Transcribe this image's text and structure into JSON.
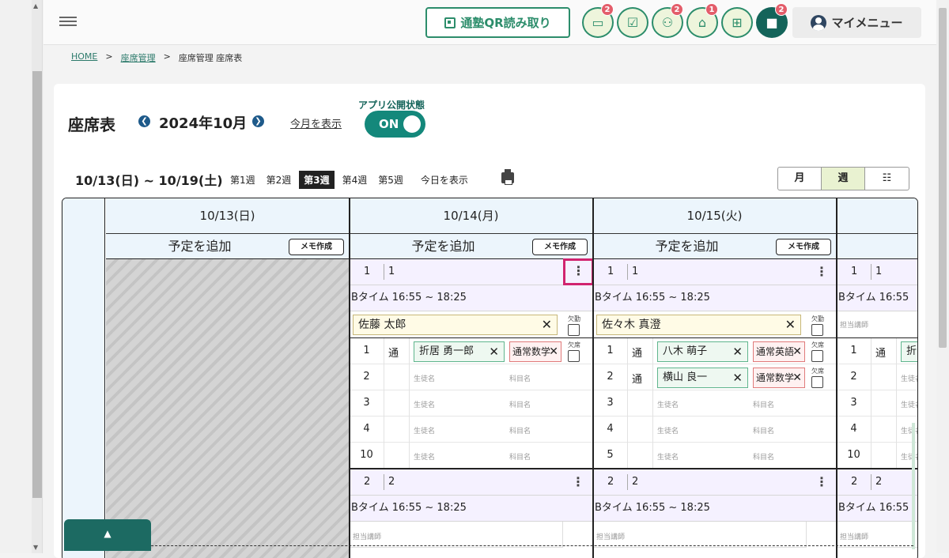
{
  "topbar": {
    "qr_label": "通塾QR読み取り",
    "badges": {
      "chat": "2",
      "survey": "",
      "people": "2",
      "school": "1",
      "gift": "",
      "message": "2"
    },
    "my_menu": "マイメニュー"
  },
  "breadcrumb": {
    "home": "HOME",
    "sep": ">",
    "seat_mgmt": "座席管理",
    "current": "座席管理 座席表"
  },
  "header": {
    "title": "座席表",
    "month": "2024年10月",
    "show_this_month": "今月を表示",
    "publish_label": "アプリ公開状態",
    "publish_toggle": "ON"
  },
  "week_bar": {
    "range": "10/13(日) ~ 10/19(土)",
    "weeks": [
      "第1週",
      "第2週",
      "第3週",
      "第4週",
      "第5週"
    ],
    "selected_week": "第3週",
    "show_today": "今日を表示",
    "views": [
      "月",
      "週",
      "☷"
    ],
    "active_view": "週"
  },
  "calendar": {
    "add_label": "予定を追加",
    "memo_label": "メモ作成",
    "days": [
      {
        "date": "10/13(日)"
      },
      {
        "date": "10/14(月)"
      },
      {
        "date": "10/15(火)"
      },
      {
        "date": ""
      }
    ],
    "placeholders": {
      "student": "生徒名",
      "subject": "科目名",
      "teacher": "担当講師",
      "absent": "欠席",
      "absent_t": "欠勤"
    },
    "cols": [
      {
        "seat1": {
          "a": "1",
          "b": "1"
        },
        "time": "Bタイム 16:55 ~ 18:25",
        "teacher": "佐藤 太郎",
        "rows": [
          {
            "num": "1",
            "type": "通",
            "student": "折居 勇一郎",
            "subject": "通常数学"
          },
          {
            "num": "2"
          },
          {
            "num": "3"
          },
          {
            "num": "4"
          },
          {
            "num": "10"
          }
        ],
        "seat2": {
          "a": "2",
          "b": "2"
        },
        "time2": "Bタイム 16:55 ~ 18:25"
      },
      {
        "seat1": {
          "a": "1",
          "b": "1"
        },
        "time": "Bタイム 16:55 ~ 18:25",
        "teacher": "佐々木 真澄",
        "rows": [
          {
            "num": "1",
            "type": "通",
            "student": "八木 萌子",
            "subject": "通常英語"
          },
          {
            "num": "2",
            "type": "通",
            "student": "横山 良一",
            "subject": "通常数学"
          },
          {
            "num": "3"
          },
          {
            "num": "4"
          },
          {
            "num": "5"
          }
        ],
        "seat2": {
          "a": "2",
          "b": "2"
        },
        "time2": "Bタイム 16:55 ~ 18:25"
      },
      {
        "seat1": {
          "a": "1",
          "b": "1"
        },
        "time": "Bタイム 16:55",
        "rows": [
          {
            "num": "1",
            "type": "通",
            "student": "折"
          },
          {
            "num": "2"
          },
          {
            "num": "3"
          },
          {
            "num": "4"
          },
          {
            "num": "10"
          }
        ],
        "seat2": {
          "a": "2",
          "b": "2"
        },
        "time2": "Bタイム 16:55"
      }
    ]
  },
  "colors": {
    "accent": "#2c8d6b",
    "dark_accent": "#14645a",
    "badge": "#e35d6a",
    "highlight": "#d1246f"
  }
}
